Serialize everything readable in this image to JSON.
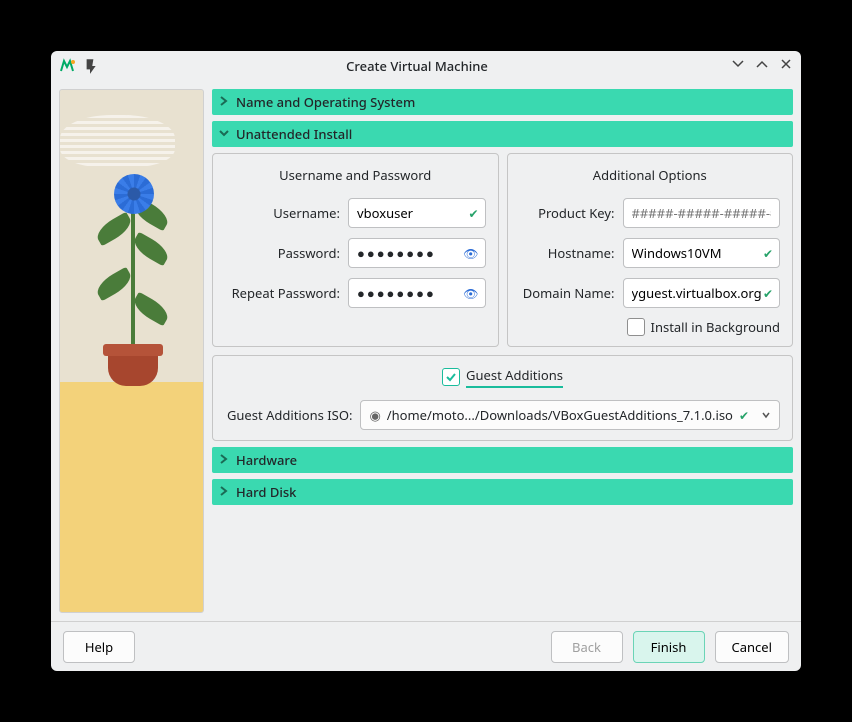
{
  "window": {
    "title": "Create Virtual Machine"
  },
  "sections": {
    "name_os": "Name and Operating System",
    "unattended": "Unattended Install",
    "hardware": "Hardware",
    "hard_disk": "Hard Disk"
  },
  "userpass": {
    "group_title": "Username and Password",
    "username_label": "Username:",
    "username_value": "vboxuser",
    "password_label": "Password:",
    "password_value": "●●●●●●●●",
    "repeat_label": "Repeat Password:",
    "repeat_value": "●●●●●●●●"
  },
  "additional": {
    "group_title": "Additional Options",
    "product_key_label": "Product Key:",
    "product_key_placeholder": "#####-#####-#####-#",
    "hostname_label": "Hostname:",
    "hostname_value": "Windows10VM",
    "domain_label": "Domain Name:",
    "domain_value": "yguest.virtualbox.org",
    "install_bg_label": "Install in Background",
    "install_bg_checked": false
  },
  "guest_additions": {
    "checkbox_label": "Guest Additions",
    "checkbox_checked": true,
    "iso_label": "Guest Additions ISO:",
    "iso_value": "/home/moto.../Downloads/VBoxGuestAdditions_7.1.0.iso"
  },
  "buttons": {
    "help": "Help",
    "back": "Back",
    "finish": "Finish",
    "cancel": "Cancel"
  }
}
